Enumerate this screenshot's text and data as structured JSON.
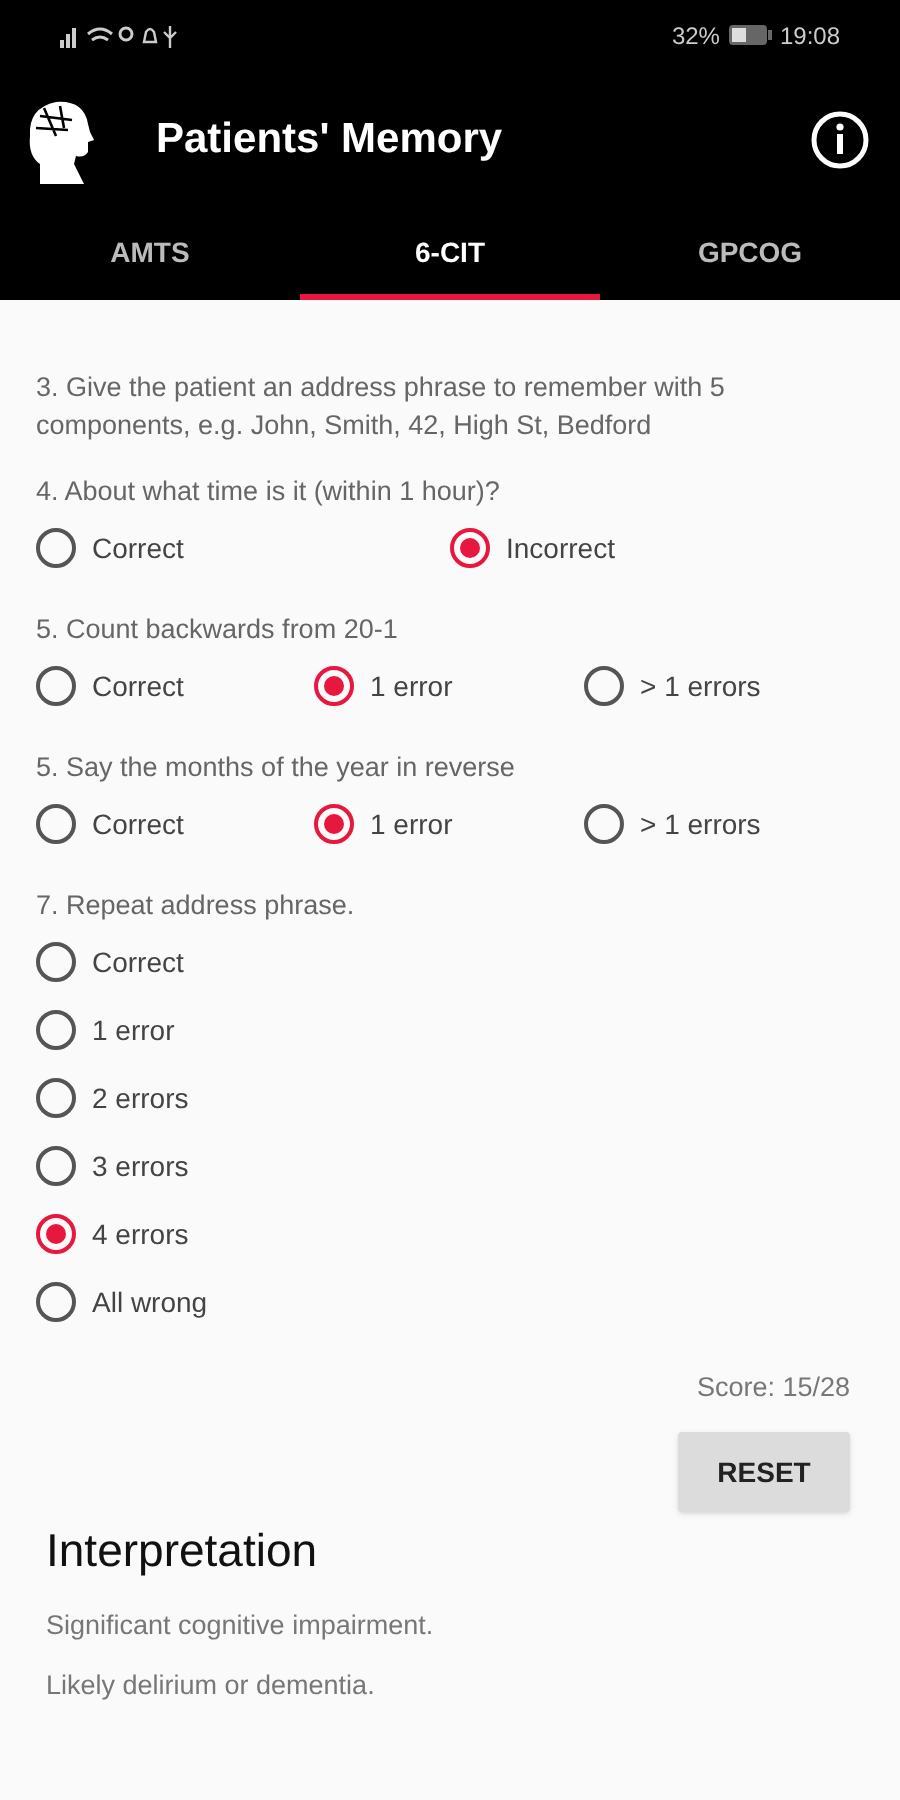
{
  "status_bar": {
    "battery_percent": "32%",
    "time": "19:08"
  },
  "app_bar": {
    "title": "Patients' Memory"
  },
  "tabs": [
    {
      "label": "AMTS",
      "selected": false
    },
    {
      "label": "6-CIT",
      "selected": true
    },
    {
      "label": "GPCOG",
      "selected": false
    }
  ],
  "questions": [
    {
      "kind": "text",
      "prompt": "3. Give the patient an address phrase to remember with 5 components, e.g. John, Smith, 42, High St, Bedford"
    },
    {
      "kind": "two",
      "prompt": "4. About what time is it (within 1 hour)?",
      "options": [
        {
          "label": "Correct",
          "selected": false
        },
        {
          "label": "Incorrect",
          "selected": true
        }
      ]
    },
    {
      "kind": "three",
      "prompt": "5. Count backwards from 20-1",
      "options": [
        {
          "label": "Correct",
          "selected": false
        },
        {
          "label": "1 error",
          "selected": true
        },
        {
          "label": "> 1 errors",
          "selected": false
        }
      ]
    },
    {
      "kind": "three",
      "prompt": "5. Say the months of the year in reverse",
      "options": [
        {
          "label": "Correct",
          "selected": false
        },
        {
          "label": "1 error",
          "selected": true
        },
        {
          "label": "> 1 errors",
          "selected": false
        }
      ]
    },
    {
      "kind": "column",
      "prompt": "7. Repeat address phrase.",
      "options": [
        {
          "label": "Correct",
          "selected": false
        },
        {
          "label": "1 error",
          "selected": false
        },
        {
          "label": "2 errors",
          "selected": false
        },
        {
          "label": "3 errors",
          "selected": false
        },
        {
          "label": "4 errors",
          "selected": true
        },
        {
          "label": "All wrong",
          "selected": false
        }
      ]
    }
  ],
  "score": "Score: 15/28",
  "reset_button": "RESET",
  "interpretation": {
    "title": "Interpretation",
    "lines": [
      "Significant cognitive impairment.",
      "Likely delirium or dementia."
    ]
  }
}
